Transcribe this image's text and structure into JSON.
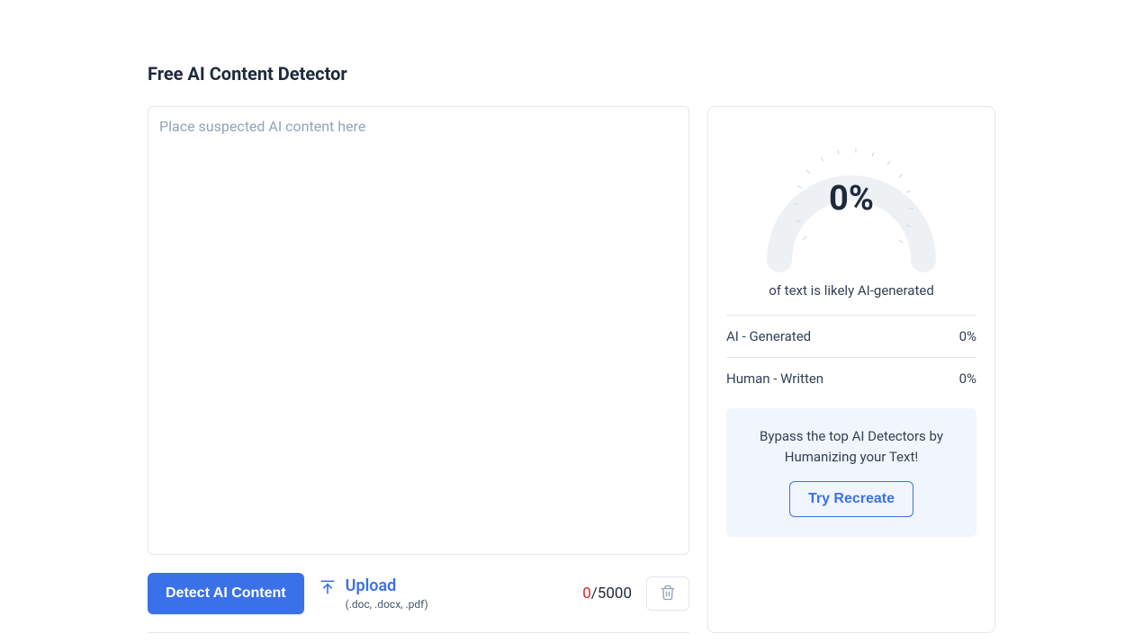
{
  "title": "Free AI Content Detector",
  "textarea": {
    "placeholder": "Place suspected AI content here",
    "value": ""
  },
  "toolbar": {
    "detect_label": "Detect AI Content",
    "upload_label": "Upload",
    "upload_formats": "(.doc, .docx, .pdf)",
    "char_current": "0",
    "char_separator": "/",
    "char_max": "5000"
  },
  "result": {
    "gauge_value": "0%",
    "caption": "of text is likely AI-generated",
    "ai_label": "AI - Generated",
    "ai_value": "0%",
    "human_label": "Human - Written",
    "human_value": "0%"
  },
  "cta": {
    "text": "Bypass the top AI Detectors by Humanizing your Text!",
    "button": "Try Recreate"
  }
}
